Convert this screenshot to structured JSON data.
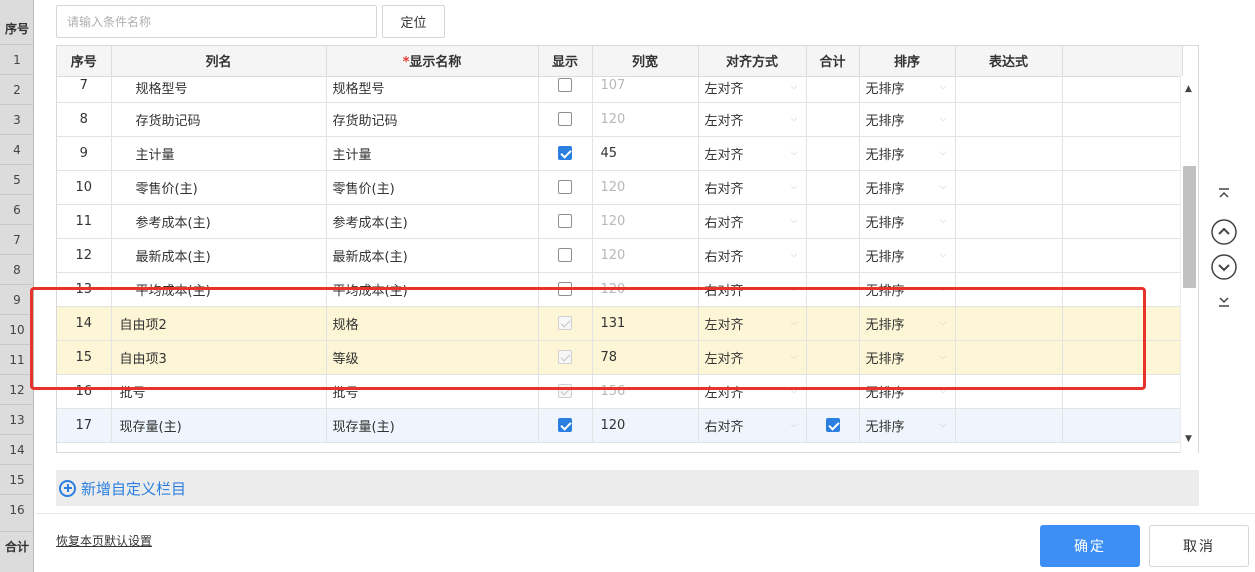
{
  "gutter": {
    "header": "序号",
    "rows": [
      "1",
      "2",
      "3",
      "4",
      "5",
      "6",
      "7",
      "8",
      "9",
      "10",
      "11",
      "12",
      "13",
      "14",
      "15",
      "16"
    ],
    "footer": "合计"
  },
  "search": {
    "placeholder": "请输入条件名称",
    "locate_label": "定位"
  },
  "table": {
    "headers": {
      "seq": "序号",
      "col_name": "列名",
      "required_mark": "*",
      "display_name": "显示名称",
      "show": "显示",
      "width": "列宽",
      "align": "对齐方式",
      "total": "合计",
      "sort": "排序",
      "expr": "表达式"
    },
    "rows": [
      {
        "seq": "7",
        "col_name": "规格型号",
        "display_name": "规格型号",
        "show": false,
        "show_disabled": false,
        "width": "107",
        "width_muted": true,
        "align": "左对齐",
        "total": false,
        "sort": "无排序",
        "expr": ""
      },
      {
        "seq": "8",
        "col_name": "存货助记码",
        "display_name": "存货助记码",
        "show": false,
        "show_disabled": false,
        "width": "120",
        "width_muted": true,
        "align": "左对齐",
        "total": false,
        "sort": "无排序",
        "expr": ""
      },
      {
        "seq": "9",
        "col_name": "主计量",
        "display_name": "主计量",
        "show": true,
        "show_disabled": false,
        "width": "45",
        "width_muted": false,
        "align": "左对齐",
        "total": false,
        "sort": "无排序",
        "expr": ""
      },
      {
        "seq": "10",
        "col_name": "零售价(主)",
        "display_name": "零售价(主)",
        "show": false,
        "show_disabled": false,
        "width": "120",
        "width_muted": true,
        "align": "右对齐",
        "total": false,
        "sort": "无排序",
        "expr": ""
      },
      {
        "seq": "11",
        "col_name": "参考成本(主)",
        "display_name": "参考成本(主)",
        "show": false,
        "show_disabled": false,
        "width": "120",
        "width_muted": true,
        "align": "右对齐",
        "total": false,
        "sort": "无排序",
        "expr": ""
      },
      {
        "seq": "12",
        "col_name": "最新成本(主)",
        "display_name": "最新成本(主)",
        "show": false,
        "show_disabled": false,
        "width": "120",
        "width_muted": true,
        "align": "右对齐",
        "total": false,
        "sort": "无排序",
        "expr": ""
      },
      {
        "seq": "13",
        "col_name": "平均成本(主)",
        "display_name": "平均成本(主)",
        "show": false,
        "show_disabled": false,
        "width": "120",
        "width_muted": true,
        "align": "右对齐",
        "total": false,
        "sort": "无排序",
        "expr": ""
      },
      {
        "seq": "14",
        "col_name": "自由项2",
        "display_name": "规格",
        "show": true,
        "show_disabled": true,
        "width": "131",
        "width_muted": false,
        "align": "左对齐",
        "total": false,
        "sort": "无排序",
        "expr": ""
      },
      {
        "seq": "15",
        "col_name": "自由项3",
        "display_name": "等级",
        "show": true,
        "show_disabled": true,
        "width": "78",
        "width_muted": false,
        "align": "左对齐",
        "total": false,
        "sort": "无排序",
        "expr": ""
      },
      {
        "seq": "16",
        "col_name": "批号",
        "display_name": "批号",
        "show": true,
        "show_disabled": true,
        "width": "156",
        "width_muted": true,
        "align": "左对齐",
        "total": false,
        "sort": "无排序",
        "expr": ""
      },
      {
        "seq": "17",
        "col_name": "现存量(主)",
        "display_name": "现存量(主)",
        "show": true,
        "show_disabled": false,
        "width": "120",
        "width_muted": false,
        "align": "右对齐",
        "total": true,
        "sort": "无排序",
        "expr": ""
      }
    ]
  },
  "add_custom_label": "新增自定义栏目",
  "restore_label": "恢复本页默认设置",
  "ok_label": "确定",
  "cancel_label": "取消",
  "colors": {
    "accent": "#3d8ff5",
    "highlight_row": "#fdf6d6",
    "selected_row": "#eef5fd",
    "annotation": "#e8332a"
  }
}
